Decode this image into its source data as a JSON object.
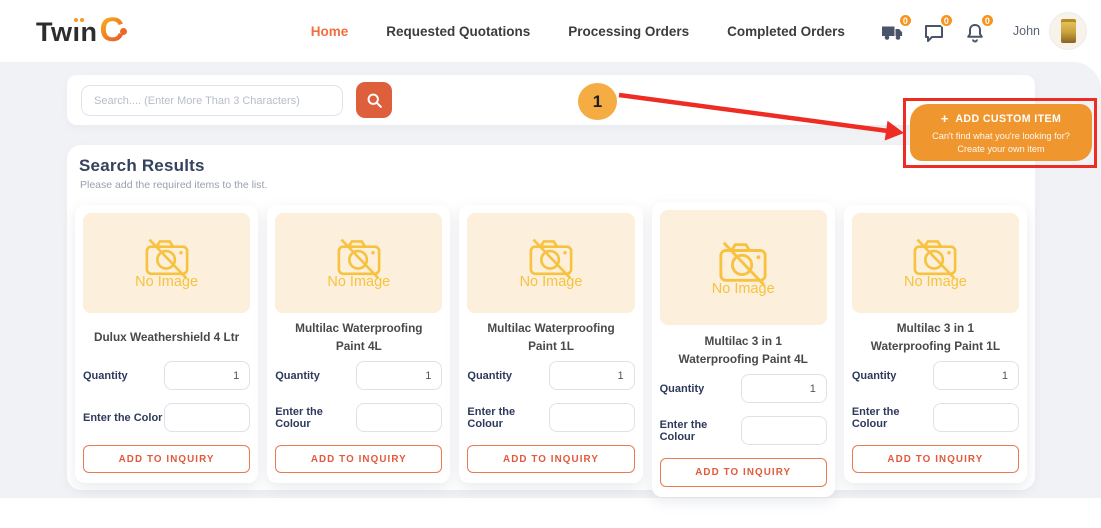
{
  "brand": {
    "name": "Tw",
    "i": "ı",
    "rest": "n",
    "accent": "C"
  },
  "nav": [
    {
      "label": "Home",
      "active": true
    },
    {
      "label": "Requested Quotations",
      "active": false
    },
    {
      "label": "Processing Orders",
      "active": false
    },
    {
      "label": "Completed Orders",
      "active": false
    }
  ],
  "header_icons": [
    {
      "name": "truck-icon",
      "badge": "0"
    },
    {
      "name": "chat-icon",
      "badge": "0"
    },
    {
      "name": "bell-icon",
      "badge": "0"
    }
  ],
  "user": {
    "name": "John"
  },
  "search": {
    "placeholder": "Search.... (Enter More Than 3 Characters)"
  },
  "annotation": {
    "step": "1"
  },
  "add_custom_item": {
    "plus": "+",
    "label": "ADD CUSTOM ITEM",
    "line1": "Can't find what you're looking for?",
    "line2": "Create your own item"
  },
  "results": {
    "title": "Search Results",
    "subtitle": "Please add the required items to the list.",
    "no_image": "No Image",
    "quantity_label": "Quantity",
    "add_button": "ADD TO INQUIRY"
  },
  "cards": [
    {
      "title": "Dulux Weathershield 4 Ltr",
      "quantity": "1",
      "color_label": "Enter the Color"
    },
    {
      "title": "Multilac Waterproofing Paint 4L",
      "quantity": "1",
      "color_label": "Enter the Colour"
    },
    {
      "title": "Multilac Waterproofing Paint 1L",
      "quantity": "1",
      "color_label": "Enter the Colour"
    },
    {
      "title": "Multilac 3 in 1 Waterproofing Paint 4L",
      "quantity": "1",
      "color_label": "Enter the Colour"
    },
    {
      "title": "Multilac 3 in 1 Waterproofing Paint 1L",
      "quantity": "1",
      "color_label": "Enter the Colour"
    }
  ],
  "colors": {
    "accent_orange": "#f2703f",
    "custom_item_orange": "#f0962f",
    "search_button": "#dd5f3c",
    "badge_orange": "#f7941e",
    "annotation_red": "#ee2c24",
    "annotation_circle": "#f5ac43",
    "noimage_bg": "#fcf0dc",
    "noimage_fg": "#f8c23f",
    "label_navy": "#2d3a5a",
    "heading_navy": "#34425e",
    "page_gray": "#f1f2f5"
  }
}
